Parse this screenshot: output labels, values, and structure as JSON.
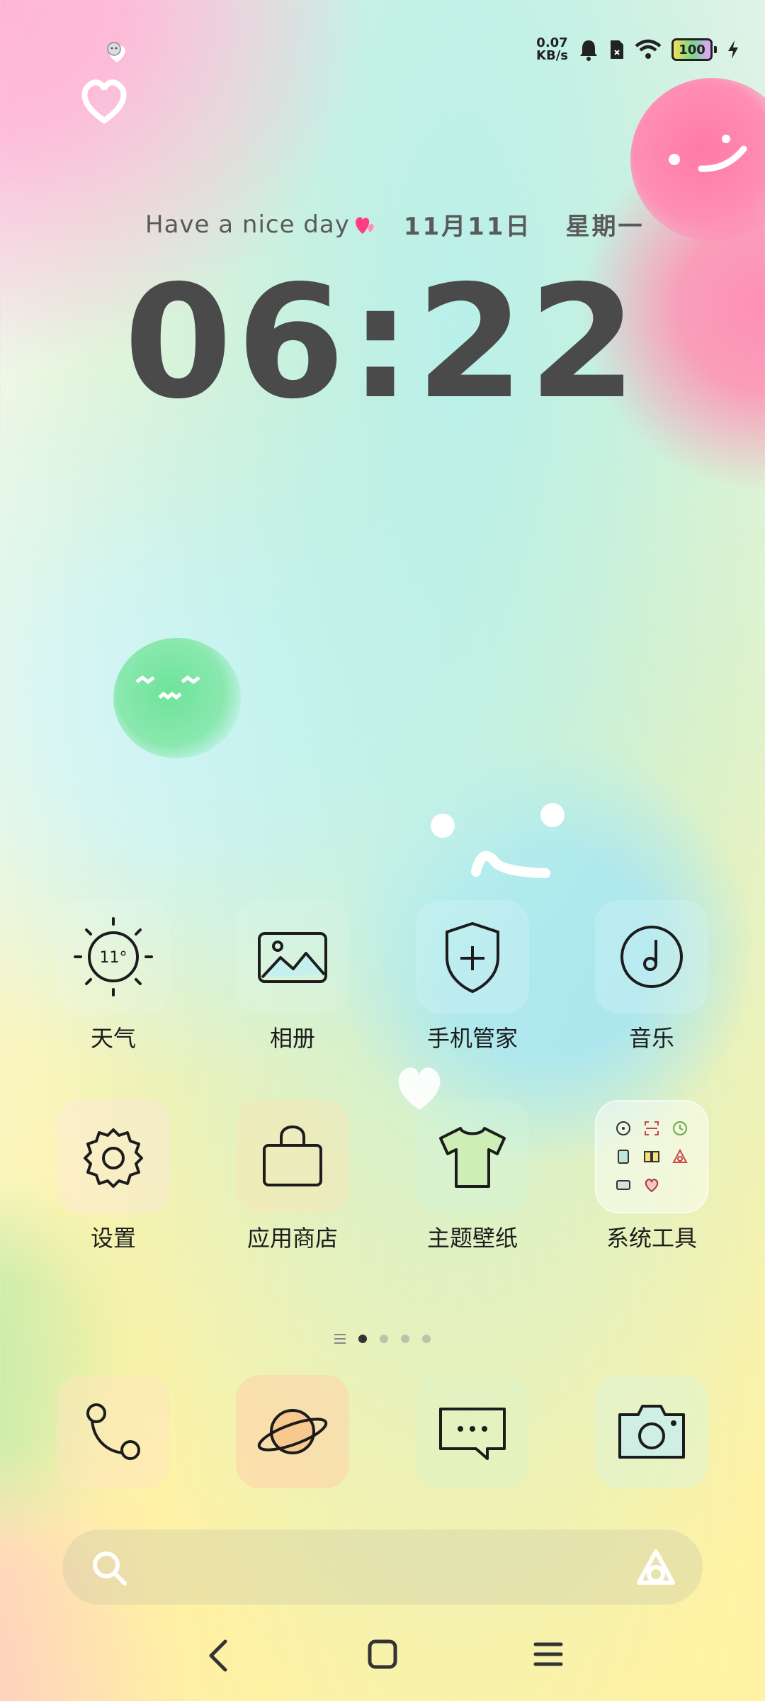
{
  "status_bar": {
    "net_speed_value": "0.07",
    "net_speed_unit": "KB/s",
    "battery_level": "100"
  },
  "clock": {
    "greeting": "Have a nice day",
    "date": "11月11日",
    "weekday": "星期一",
    "time": "06:22"
  },
  "apps": {
    "weather": {
      "label": "天气",
      "temperature": "11°"
    },
    "gallery": {
      "label": "相册"
    },
    "phone_manager": {
      "label": "手机管家"
    },
    "music": {
      "label": "音乐"
    },
    "settings": {
      "label": "设置"
    },
    "app_store": {
      "label": "应用商店"
    },
    "themes": {
      "label": "主题壁纸"
    },
    "system_tools": {
      "label": "系统工具"
    }
  },
  "pager": {
    "pages": 4,
    "active_page": 1
  },
  "colors": {
    "clock_text": "#4a4a4a",
    "icon_stroke": "#1c1c1c",
    "heart_accent": "#ff3d7f"
  }
}
